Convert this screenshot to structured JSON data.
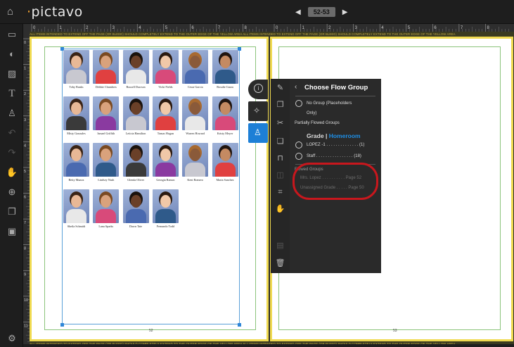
{
  "app": {
    "logo": "pictavo"
  },
  "page_nav": {
    "current": "52-53",
    "prev_icon": "triangle-left-icon",
    "next_icon": "triangle-right-icon"
  },
  "bleed_notice": "ALL ITEMS INTENDED TO EXTEND OFF THE PAGE (OR BLEED) SHOULD COMPLETELY EXTEND TO THE OUTER EDGE OF THE YELLOW AREA",
  "ruler": {
    "top_left": [
      "0",
      "1",
      "2",
      "3",
      "4",
      "5",
      "6",
      "7",
      "8"
    ],
    "top_right": [
      "0",
      "1",
      "2",
      "3",
      "4",
      "5",
      "6",
      "7",
      "8"
    ],
    "left": [
      "0",
      "1",
      "2",
      "3",
      "4",
      "5",
      "6",
      "7",
      "8",
      "9",
      "10",
      "11"
    ]
  },
  "pages": {
    "left_number": "52",
    "right_number": "53"
  },
  "students": [
    {
      "name": "Toby Banks"
    },
    {
      "name": "Debbie Chambers"
    },
    {
      "name": "Russell Dawson"
    },
    {
      "name": "Vicki Fields"
    },
    {
      "name": "Cesar Garcia"
    },
    {
      "name": "Rosalie Garza"
    },
    {
      "name": "Misty Gonzales"
    },
    {
      "name": "Ismael Griffith"
    },
    {
      "name": "Leticia Hamilton"
    },
    {
      "name": "Tomas Hogan"
    },
    {
      "name": "Warren Howard"
    },
    {
      "name": "Kristy Meyer"
    },
    {
      "name": "Betty Munoz"
    },
    {
      "name": "Lindsey Nash"
    },
    {
      "name": "Glenda Oliver"
    },
    {
      "name": "Georgia Ramos"
    },
    {
      "name": "Kent Romero"
    },
    {
      "name": "Marta Sanchez"
    },
    {
      "name": "Sheila Schmidt"
    },
    {
      "name": "Lana Sparks"
    },
    {
      "name": "Dawn Tate"
    },
    {
      "name": "Fernando Todd"
    }
  ],
  "panel": {
    "title": "Choose Flow Group",
    "back_icon": "chevron-left-icon",
    "no_group_line1": "No Group (Placeholders",
    "no_group_line2": "Only)",
    "partial_heading": "Partially Flowed Groups",
    "grade_label": "Grade",
    "grade_sep": "|",
    "homeroom_label": "Homeroom",
    "partial_groups": [
      {
        "label": "LOPEZ -1 . . . . . . . . . . . . . . (1)"
      },
      {
        "label": "Staff . . . . . . . . . . . . . . . . (18)"
      }
    ],
    "flowed_heading": "Flowed Groups",
    "flowed_groups": [
      {
        "label": "Mrs. Lopez . . . . . . . . . . Page 52"
      },
      {
        "label": "Unassigned Grade . . . . . Page 50"
      }
    ]
  },
  "colors": {
    "accent": "#1e90e8",
    "highlight": "#c8171d",
    "bleed": "#f0da50",
    "trim": "#8bc47b"
  }
}
